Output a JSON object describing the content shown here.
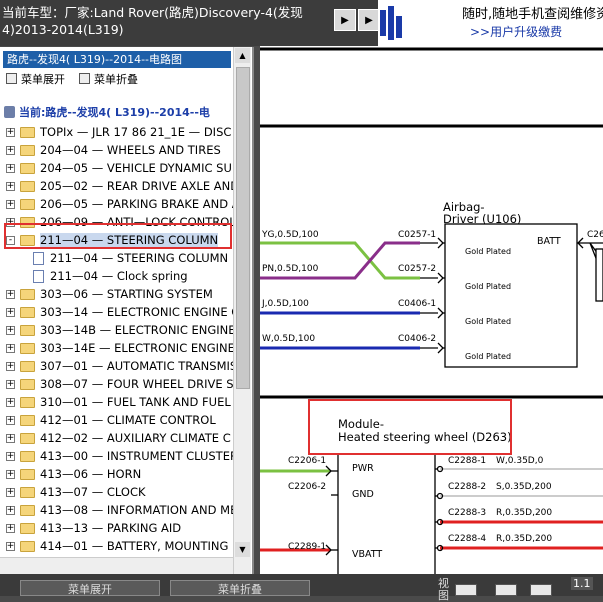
{
  "header": {
    "title_line1": "当前车型：厂家:Land Rover(路虎)Discovery-4(发现",
    "title_line2": "4)2013-2014(L319)",
    "nav_buttons": [
      "▶",
      "▶"
    ],
    "promo_line1": "随时,随地手机查阅维修资",
    "promo_line2": ">>用户升级缴费"
  },
  "left_panel": {
    "header": "路虎--发现4( L319)--2014--电路图",
    "menu_expand": "菜单展开",
    "menu_collapse": "菜单折叠",
    "current": "当前:路虎--发现4( L319)--2014--电",
    "tree": [
      {
        "label": "TOPIx — JLR 17 86 21_1E — DISC",
        "pm": "+",
        "icon": "folder",
        "level": 0
      },
      {
        "label": "204—04 — WHEELS AND TIRES",
        "pm": "+",
        "icon": "folder",
        "level": 0
      },
      {
        "label": "204—05 — VEHICLE DYNAMIC SU",
        "pm": "+",
        "icon": "folder",
        "level": 0
      },
      {
        "label": "205—02 — REAR DRIVE AXLE AND",
        "pm": "+",
        "icon": "folder",
        "level": 0
      },
      {
        "label": "206—05 — PARKING BRAKE AND A",
        "pm": "+",
        "icon": "folder",
        "level": 0
      },
      {
        "label": "206—09 — ANTI—LOCK CONTROL",
        "pm": "+",
        "icon": "folder",
        "level": 0
      },
      {
        "label": "211—04 — STEERING COLUMN",
        "pm": "-",
        "icon": "folder",
        "level": 0,
        "selected": true
      },
      {
        "label": "211—04 — STEERING COLUMN",
        "pm": "",
        "icon": "doc",
        "level": 1
      },
      {
        "label": "211—04 — Clock spring",
        "pm": "",
        "icon": "doc",
        "level": 1
      },
      {
        "label": "303—06 — STARTING SYSTEM",
        "pm": "+",
        "icon": "folder",
        "level": 0
      },
      {
        "label": "303—14 — ELECTRONIC ENGINE C",
        "pm": "+",
        "icon": "folder",
        "level": 0
      },
      {
        "label": "303—14B — ELECTRONIC ENGINE",
        "pm": "+",
        "icon": "folder",
        "level": 0
      },
      {
        "label": "303—14E — ELECTRONIC ENGINE",
        "pm": "+",
        "icon": "folder",
        "level": 0
      },
      {
        "label": "307—01 — AUTOMATIC TRANSMIS",
        "pm": "+",
        "icon": "folder",
        "level": 0
      },
      {
        "label": "308—07 — FOUR WHEEL DRIVE SY",
        "pm": "+",
        "icon": "folder",
        "level": 0
      },
      {
        "label": "310—01 — FUEL TANK AND FUEL",
        "pm": "+",
        "icon": "folder",
        "level": 0
      },
      {
        "label": "412—01 — CLIMATE CONTROL",
        "pm": "+",
        "icon": "folder",
        "level": 0
      },
      {
        "label": "412—02 — AUXILIARY CLIMATE C",
        "pm": "+",
        "icon": "folder",
        "level": 0
      },
      {
        "label": "413—00 — INSTRUMENT CLUSTER",
        "pm": "+",
        "icon": "folder",
        "level": 0
      },
      {
        "label": "413—06 — HORN",
        "pm": "+",
        "icon": "folder",
        "level": 0
      },
      {
        "label": "413—07 — CLOCK",
        "pm": "+",
        "icon": "folder",
        "level": 0
      },
      {
        "label": "413—08 — INFORMATION AND ME",
        "pm": "+",
        "icon": "folder",
        "level": 0
      },
      {
        "label": "413—13 — PARKING AID",
        "pm": "+",
        "icon": "folder",
        "level": 0
      },
      {
        "label": "414—01 — BATTERY, MOUNTING",
        "pm": "+",
        "icon": "folder",
        "level": 0
      }
    ]
  },
  "diagram": {
    "airbag_title1": "Airbag-",
    "airbag_title2": "Driver (U106)",
    "batt": "BATT",
    "gold_plated": "Gold Plated",
    "wires_left": [
      "YG,0.5D,100",
      "PN,0.5D,100",
      "J,0.5D,100",
      "W,0.5D,100"
    ],
    "conn_left": [
      "C0257-1",
      "C0257-2",
      "C0406-1",
      "C0406-2"
    ],
    "c26": "C26",
    "module_title1": "Module-",
    "module_title2": "Heated steering wheel (D263)",
    "pwr": "PWR",
    "gnd": "GND",
    "vbatt": "VBATT",
    "conn_mod_left": [
      "C2206-1",
      "C2206-2",
      "C2289-1"
    ],
    "conn_mod_right": [
      "C2288-1",
      "C2288-2",
      "C2288-3",
      "C2288-4"
    ],
    "wires_right": [
      "W,0.35D,0",
      "S,0.35D,200",
      "R,0.35D,200",
      "R,0.35D,200"
    ]
  },
  "bottom": {
    "btn_expand": "菜单展开",
    "btn_collapse": "菜单折叠",
    "view_label": "视图",
    "version": "1.1"
  },
  "colors": {
    "highlight_red": "#e03030",
    "tree_selected_bg": "#c9d8ee",
    "header_blue": "#1e5fa8",
    "wire_green": "#7bc142",
    "wire_purple": "#8a2e8a",
    "wire_blue": "#1a2ab0",
    "wire_red": "#e02020"
  }
}
